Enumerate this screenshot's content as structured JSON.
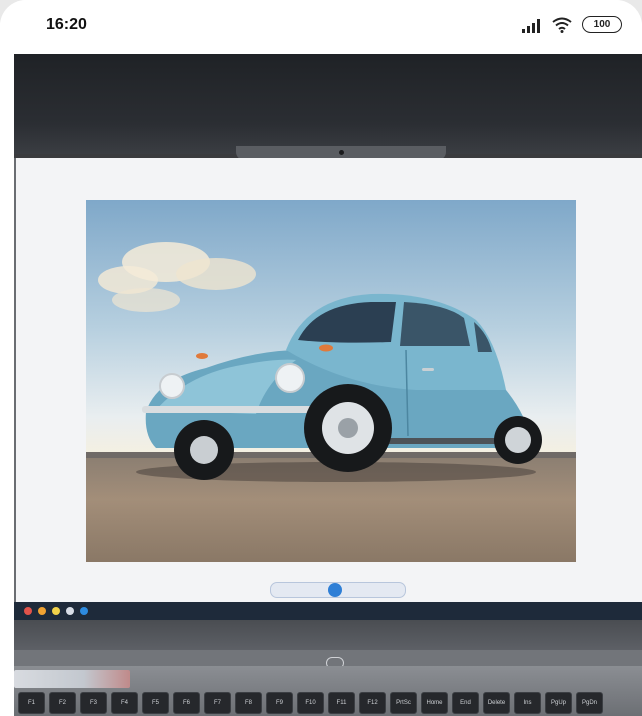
{
  "status_bar": {
    "time": "16:20",
    "battery": "100",
    "icons": [
      "signal-icon",
      "wifi-icon",
      "battery-icon"
    ]
  },
  "photo": {
    "subject": "vintage-beetle-car",
    "colors": {
      "car_body": "#79b4cc",
      "sky": "#9fc2d9",
      "ground": "#9a8774",
      "laptop_frame": "#2b2e33"
    }
  },
  "keyboard": {
    "keys": [
      "F1",
      "F2",
      "F3",
      "F4",
      "F5",
      "F6",
      "F7",
      "F8",
      "F9",
      "F10",
      "F11",
      "F12",
      "PrtSc",
      "Home",
      "End",
      "Delete",
      "Ins",
      "PgUp",
      "PgDn"
    ]
  }
}
